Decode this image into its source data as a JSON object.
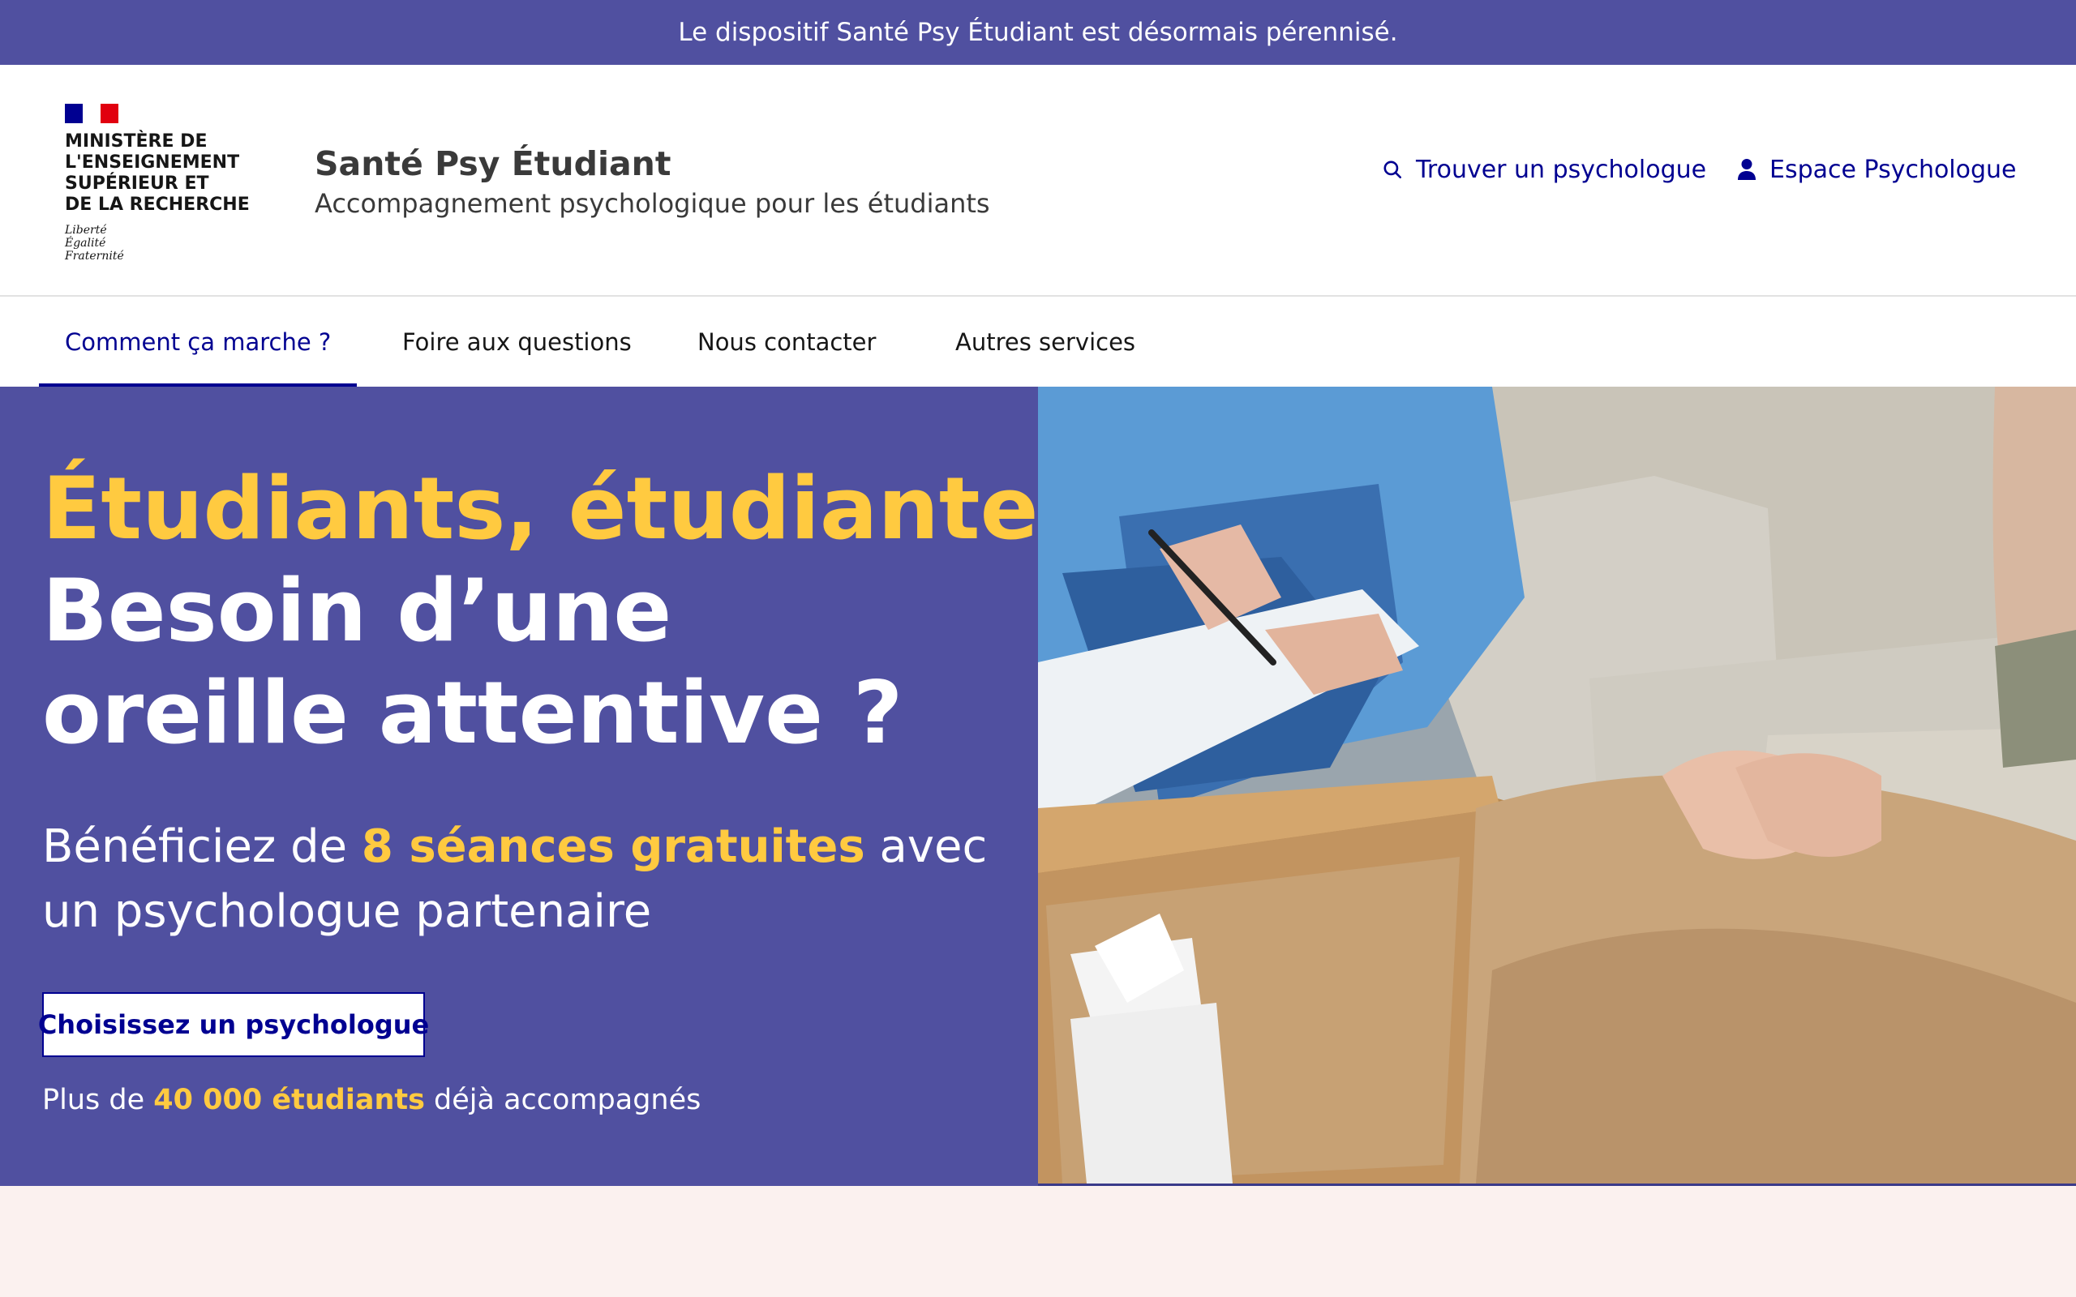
{
  "notice": {
    "text": "Le dispositif Santé Psy Étudiant est désormais pérennisé."
  },
  "header": {
    "ministry_lines": [
      "MINISTÈRE DE",
      "L'ENSEIGNEMENT",
      "SUPÉRIEUR ET",
      "DE LA RECHERCHE"
    ],
    "motto_lines": [
      "Liberté",
      "Égalité",
      "Fraternité"
    ],
    "site_name": "Santé Psy Étudiant",
    "tagline": "Accompagnement psychologique pour les étudiants",
    "tools": {
      "find_label": "Trouver un psychologue",
      "space_label": "Espace Psychologue"
    }
  },
  "nav": {
    "items": [
      {
        "label": "Comment ça marche ?",
        "active": true
      },
      {
        "label": "Foire aux questions",
        "active": false
      },
      {
        "label": "Nous contacter",
        "active": false
      },
      {
        "label": "Autres services",
        "active": false
      }
    ]
  },
  "hero": {
    "title_highlight": "Étudiants, étudiantes",
    "title_rest": "Besoin d’une oreille attentive ?",
    "sub_prefix": "Bénéficiez de ",
    "sub_highlight": "8 séances gratuites",
    "sub_suffix": " avec un psychologue partenaire",
    "cta_label": "Choisissez un psychologue",
    "stats_prefix": "Plus de ",
    "stats_highlight": "40 000 étudiants",
    "stats_suffix": " déjà accompagnés"
  },
  "colors": {
    "primary": "#000091",
    "hero_bg": "#5050a0",
    "accent_yellow": "#ffca40",
    "flag_red": "#e1000f",
    "footer_bg": "#fbf1ef"
  },
  "icons": {
    "find": "search-icon",
    "space": "user-icon"
  }
}
